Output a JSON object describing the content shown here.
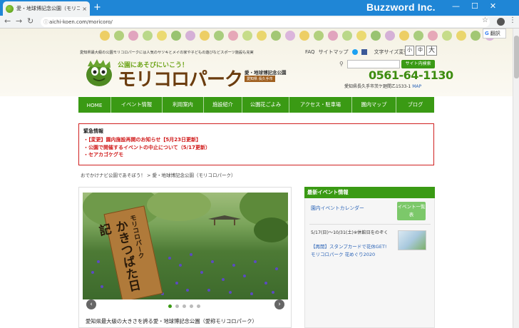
{
  "browser": {
    "tab_title": "愛・地球博記念公園（モリコロパーク）",
    "tab_close": "×",
    "new_tab": "+",
    "brand": "Buzzword Inc.",
    "url": "aichi-koen.com/moricoro/",
    "minimize": "—",
    "maximize": "☐",
    "close": "✕",
    "translate_label": "翻訳"
  },
  "header": {
    "tagline": "愛知県最大級の公園モリコロパークには人気のサツキとメイの家や子どもの遊びなどスポーツ施設も充実",
    "links": [
      "FAQ",
      "サイトマップ"
    ],
    "font_size_label": "文字サイズ変更",
    "font_sizes": [
      "小",
      "中",
      "大"
    ],
    "logo_sub": "公園にあそびにいこう！",
    "logo_main": "モリコロパーク",
    "park_name": "愛・地球博記念公園",
    "park_badge": "愛知県 長久手市",
    "search_button": "サイト内検索",
    "phone": "0561-64-1130",
    "address": "愛知県長久手市茨ケ廻間乙1533-1",
    "map_link": "MAP"
  },
  "nav": [
    "HOME",
    "イベント情報",
    "利用案内",
    "施設紹介",
    "公園花ごよみ",
    "アクセス・駐車場",
    "園内マップ",
    "ブログ"
  ],
  "notice": {
    "heading": "緊急情報",
    "items": [
      "・【変更】園内施設再開のお知らせ【5月23日更新】",
      "・公園で開催するイベントの中止について（5/17更新）",
      "・セアカゴケグモ"
    ]
  },
  "breadcrumb": "おでかけナビ公園であそぼう！ > 愛・地球博記念公園（モリコロパーク）",
  "slider": {
    "sign_small": "モリコロパーク",
    "sign_big": "かきつばた日記",
    "caption": "愛知県最大級の大きさを誇る愛・地球博記念公園（愛称モリコロパーク）",
    "prev": "‹",
    "next": "›"
  },
  "sidebar": {
    "heading": "最新イベント情報",
    "ev1_link": "園内イベントカレンダー",
    "ev1_button": "イベント一覧表",
    "ev2_date": "5/17(日)〜10/31(土)※休館日をのぞく",
    "ev2_title": "【再開】スタンプカードで花休GET!モリコロパーク 花めぐり2020"
  }
}
